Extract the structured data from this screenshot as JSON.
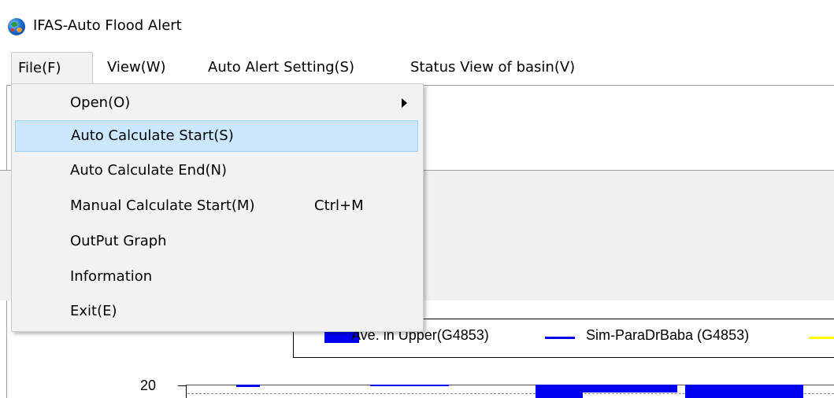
{
  "window": {
    "title": "IFAS-Auto Flood Alert"
  },
  "menubar": {
    "items": [
      {
        "label": "File(F)"
      },
      {
        "label": "View(W)"
      },
      {
        "label": "Auto Alert Setting(S)"
      },
      {
        "label": "Status View of basin(V)"
      }
    ]
  },
  "file_menu": {
    "items": [
      {
        "label": "Open(O)",
        "submenu": true
      },
      {
        "label": "Auto Calculate Start(S)",
        "highlighted": true
      },
      {
        "label": "Auto Calculate End(N)"
      },
      {
        "label": "Manual Calculate Start(M)",
        "shortcut": "Ctrl+M"
      },
      {
        "label": "OutPut Graph"
      },
      {
        "label": "Information"
      },
      {
        "label": "Exit(E)"
      }
    ]
  },
  "chart": {
    "legend": [
      {
        "label": "Ave. in Upper(G4853)",
        "color": "#0000f0"
      },
      {
        "label": "Sim-ParaDrBaba (G4853)",
        "color": "#0000f0"
      },
      {
        "color": "#ffff00"
      }
    ],
    "y_tick_label": "20"
  }
}
